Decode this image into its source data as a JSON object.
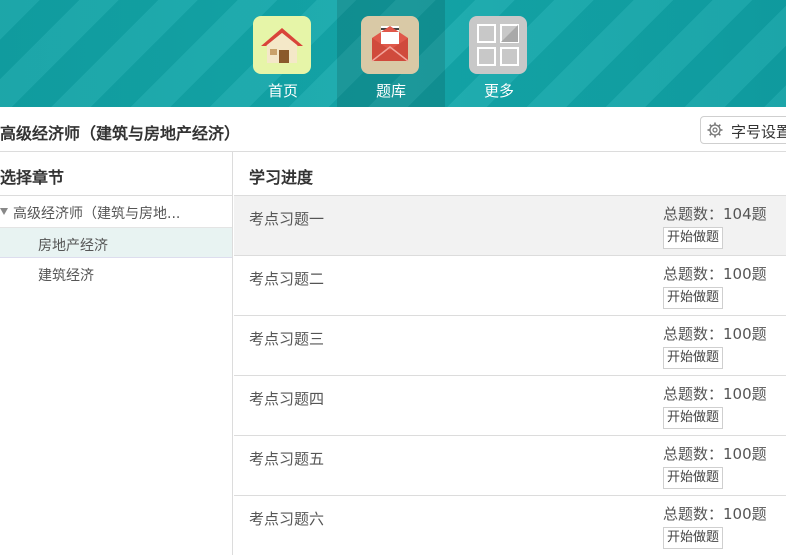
{
  "nav": {
    "items": [
      {
        "label": "首页",
        "icon": "home-icon"
      },
      {
        "label": "题库",
        "icon": "mail-icon"
      },
      {
        "label": "更多",
        "icon": "grid-icon"
      }
    ],
    "active": "题库"
  },
  "header": {
    "title": "高级经济师（建筑与房地产经济）",
    "font_settings_label": "字号设置",
    "font_settings_icon": "gear-icon"
  },
  "chapters": {
    "heading": "选择章节",
    "root": "高级经济师（建筑与房地...",
    "items": [
      "房地产经济",
      "建筑经济"
    ],
    "selected": "房地产经济"
  },
  "progress": {
    "heading": "学习进度",
    "total_prefix": "总题数：",
    "start_label": "开始做题",
    "exercises": [
      {
        "name": "考点习题一",
        "total": "总题数：104题"
      },
      {
        "name": "考点习题二",
        "total": "总题数：100题"
      },
      {
        "name": "考点习题三",
        "total": "总题数：100题"
      },
      {
        "name": "考点习题四",
        "total": "总题数：100题"
      },
      {
        "name": "考点习题五",
        "total": "总题数：100题"
      },
      {
        "name": "考点习题六",
        "total": "总题数：100题"
      }
    ]
  },
  "colors": {
    "header_bg": "#12a4a7",
    "selected_row": "#e8f3f2",
    "home_tile": "#e6f5a8",
    "mail_tile": "#d9c9a6",
    "grid_tile": "#c8c8c8"
  }
}
